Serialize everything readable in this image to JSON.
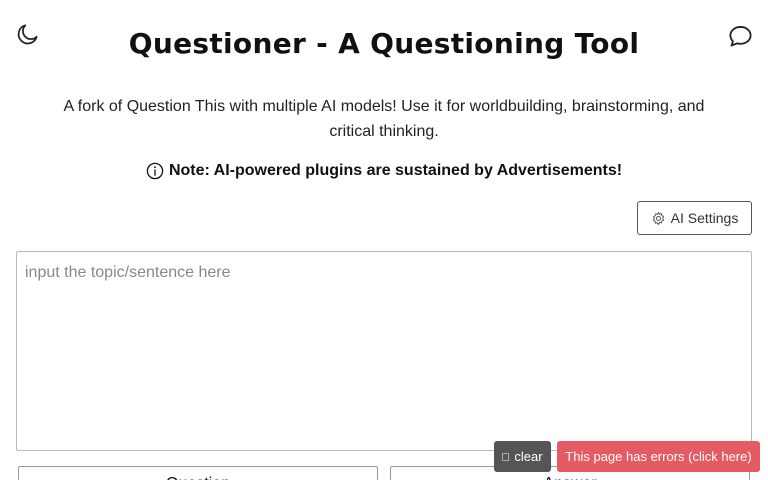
{
  "header": {
    "title": "Questioner - A Questioning Tool",
    "theme_icon": "moon-icon",
    "feedback_icon": "chat-bubble-icon"
  },
  "intro": {
    "description": "A fork of Question This with multiple AI models! Use it for worldbuilding, brainstorming, and critical thinking.",
    "note": "Note: AI-powered plugins are sustained by Advertisements!",
    "note_icon": "info-circle-icon"
  },
  "settings": {
    "label": "AI Settings",
    "icon": "gear-icon"
  },
  "topic": {
    "placeholder": "input the topic/sentence here",
    "value": ""
  },
  "actions": {
    "question_label": "Question",
    "answer_label": "Answer"
  },
  "overlay": {
    "clear_label": "clear",
    "error_label": "This page has errors (click here)"
  },
  "colors": {
    "error_bg": "#e45b63",
    "clear_bg": "#555555"
  }
}
